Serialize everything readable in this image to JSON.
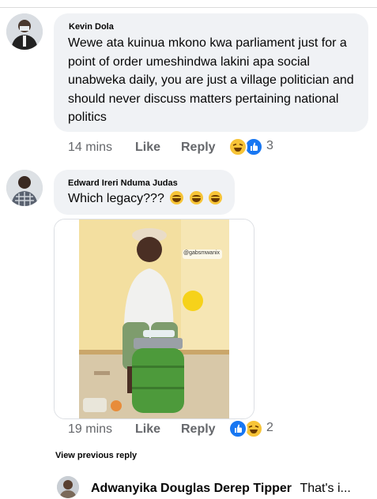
{
  "comments": [
    {
      "author": "Kevin Dola",
      "text": "Wewe ata kuinua mkono kwa parliament just for a point of order umeshindwa lakini apa social unabweka daily, you are just a village politician and should never discuss matters pertaining national politics",
      "time": "14 mins",
      "like_label": "Like",
      "reply_label": "Reply",
      "reaction_count": "3"
    },
    {
      "author": "Edward Ireri Nduma Judas",
      "text": "Which legacy???",
      "emoji": [
        "laughing-crying",
        "laughing-crying",
        "laughing-crying"
      ],
      "watermark": "@gabsmwanix",
      "time": "19 mins",
      "like_label": "Like",
      "reply_label": "Reply",
      "reaction_count": "2"
    }
  ],
  "view_previous_reply": "View previous reply",
  "reply_preview": {
    "author": "Adwanyika Douglas Derep Tipper",
    "snippet": "That's i..."
  },
  "colors": {
    "bubble": "#f0f2f5",
    "meta": "#65676b",
    "like_blue": "#1877f2",
    "haha_yellow": "#f7c437"
  }
}
